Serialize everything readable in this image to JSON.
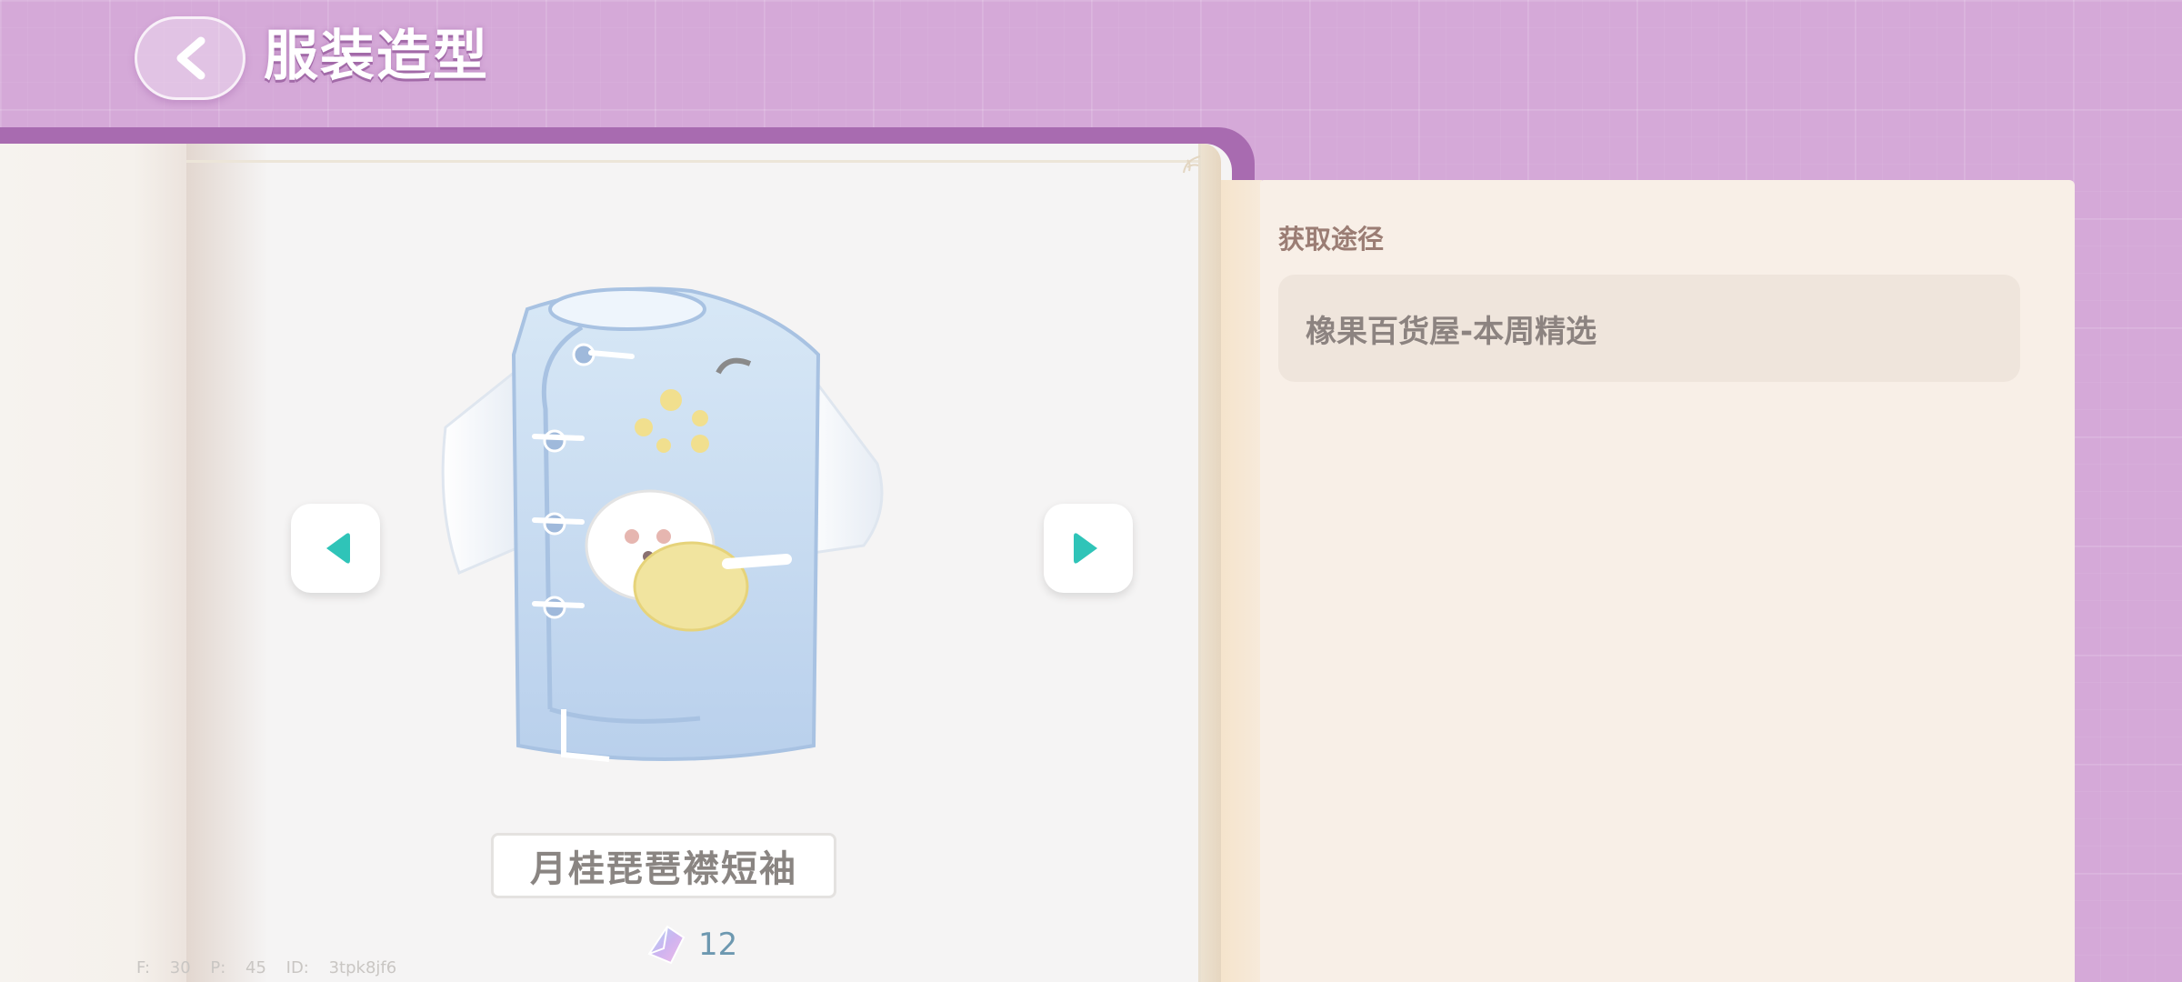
{
  "header": {
    "title": "服装造型",
    "back_icon": "chevron-left-icon"
  },
  "item": {
    "name": "月桂琵琶襟短袖",
    "image_description_icon": "blue-shirt-with-bunny-embroidery",
    "count": "12",
    "count_icon": "crystal-shard-icon",
    "prev_icon": "triangle-left-icon",
    "next_icon": "triangle-right-icon"
  },
  "source": {
    "label": "获取途径",
    "value": "橡果百货屋-本周精选"
  },
  "debug": {
    "text": "F: 30 P: 45 ID: 3tpk8jf6"
  },
  "colors": {
    "background": "#d5a9d8",
    "book_tab": "#a86bb0",
    "arrow_accent": "#2fc4b8",
    "panel": "#f8efe7"
  }
}
